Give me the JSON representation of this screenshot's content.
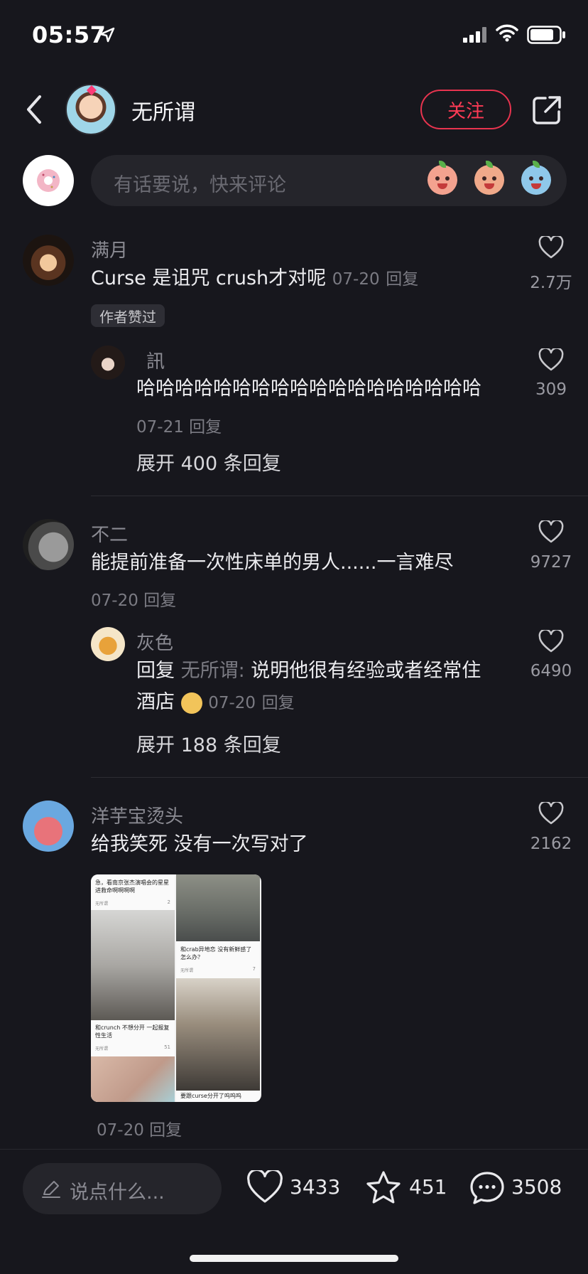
{
  "status_bar": {
    "time": "05:57"
  },
  "header": {
    "author_name": "无所谓",
    "follow_label": "关注"
  },
  "comment_input": {
    "placeholder": "有话要说，快来评论"
  },
  "comments": [
    {
      "name": "满月",
      "text": "Curse 是诅咒 crush才对呢",
      "date": "07-20",
      "reply_label": "回复",
      "likes": "2.7万",
      "badge": "作者赞过",
      "replies": [
        {
          "name": "訊",
          "text": "哈哈哈哈哈哈哈哈哈哈哈哈哈哈哈哈哈哈",
          "date": "07-21",
          "reply_label": "回复",
          "likes": "309"
        }
      ],
      "expand_label": "展开 400 条回复"
    },
    {
      "name": "不二",
      "text": "能提前准备一次性床单的男人......一言难尽",
      "date": "07-20",
      "reply_label": "回复",
      "likes": "9727",
      "replies": [
        {
          "name": "灰色",
          "prefix": "回复",
          "reply_to": "无所谓:",
          "text_line1": "说明他很有经验或者经常住",
          "text_line2": "酒店",
          "date": "07-20",
          "reply_label": "回复",
          "likes": "6490"
        }
      ],
      "expand_label": "展开 188 条回复"
    },
    {
      "name": "洋芋宝烫头",
      "text": "给我笑死 没有一次写对了",
      "date": "07-20",
      "reply_label": "回复",
      "likes": "2162",
      "image_cards": [
        {
          "text": "急，看南京张杰演唱会的星星进救命啊啊啊啊",
          "user": "无所谓",
          "likes": "2"
        },
        {
          "text": "和crab异地恋 没有新鲜感了 怎么办？",
          "user": "无所谓",
          "likes": "7"
        },
        {
          "text": "和crunch 不想分开 一起报复性生活",
          "user": "无所谓",
          "likes": "51"
        },
        {
          "text": "要跟curse分开了呜呜呜",
          "user": "",
          "likes": ""
        }
      ]
    }
  ],
  "bottom_bar": {
    "placeholder": "说点什么...",
    "likes": "3433",
    "stars": "451",
    "comments": "3508"
  },
  "colors": {
    "background": "#17171d",
    "accent": "#ff3b55"
  }
}
